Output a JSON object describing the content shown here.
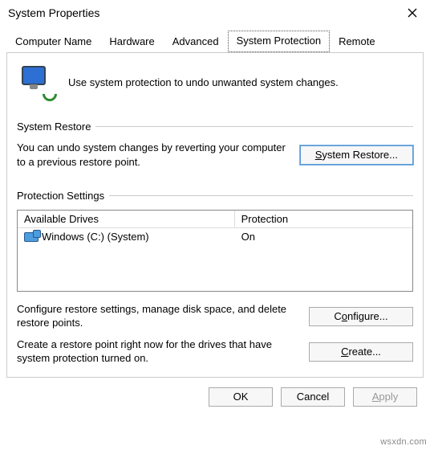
{
  "window": {
    "title": "System Properties",
    "close_icon": "close-icon"
  },
  "tabs": [
    {
      "label": "Computer Name",
      "active": false
    },
    {
      "label": "Hardware",
      "active": false
    },
    {
      "label": "Advanced",
      "active": false
    },
    {
      "label": "System Protection",
      "active": true
    },
    {
      "label": "Remote",
      "active": false
    }
  ],
  "hero": {
    "text": "Use system protection to undo unwanted system changes."
  },
  "restore_group": {
    "title": "System Restore",
    "desc": "You can undo system changes by reverting your computer to a previous restore point.",
    "button_prefix": "S",
    "button_suffix": "ystem Restore..."
  },
  "protection_group": {
    "title": "Protection Settings",
    "col_drives": "Available Drives",
    "col_protection": "Protection",
    "rows": [
      {
        "name": "Windows (C:) (System)",
        "status": "On"
      }
    ],
    "configure_desc": "Configure restore settings, manage disk space, and delete restore points.",
    "configure_btn_prefix": "C",
    "configure_btn_suffix": "onfigure...",
    "create_desc": "Create a restore point right now for the drives that have system protection turned on.",
    "create_btn_prefix": "C",
    "create_btn_suffix": "reate..."
  },
  "dialog_buttons": {
    "ok": "OK",
    "cancel": "Cancel",
    "apply_prefix": "A",
    "apply_suffix": "pply"
  },
  "watermark": "wsxdn.com"
}
